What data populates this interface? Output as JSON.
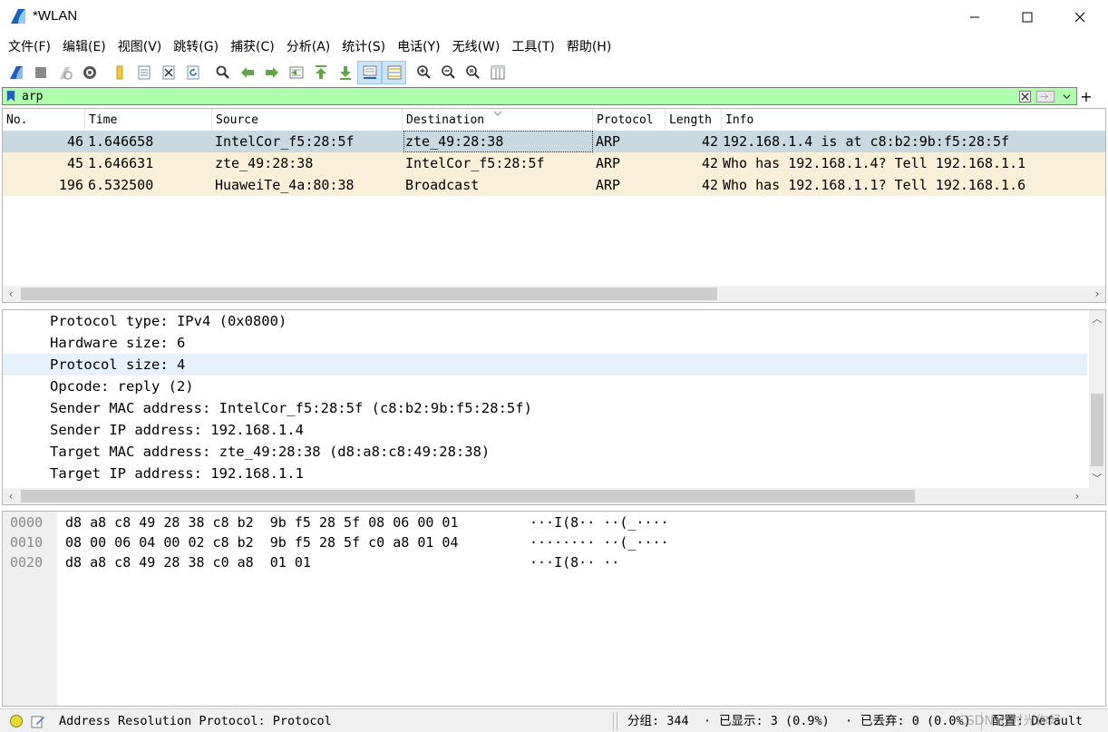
{
  "window": {
    "title": "*WLAN",
    "minimize": "minimize",
    "maximize": "maximize",
    "close": "close"
  },
  "menu": [
    {
      "label": "文件(F)"
    },
    {
      "label": "编辑(E)"
    },
    {
      "label": "视图(V)"
    },
    {
      "label": "跳转(G)"
    },
    {
      "label": "捕获(C)"
    },
    {
      "label": "分析(A)"
    },
    {
      "label": "统计(S)"
    },
    {
      "label": "电话(Y)"
    },
    {
      "label": "无线(W)"
    },
    {
      "label": "工具(T)"
    },
    {
      "label": "帮助(H)"
    }
  ],
  "toolbar": {
    "icons": [
      "shark-fin-start-icon",
      "stop-square-icon",
      "restart-fin-icon",
      "gear-options-icon",
      "folder-open-icon",
      "file-save-icon",
      "file-close-icon",
      "reload-icon",
      "search-icon",
      "arrow-back-icon",
      "arrow-forward-icon",
      "go-to-packet-icon",
      "arrow-up-first-icon",
      "arrow-down-last-icon",
      "autoscroll-icon",
      "colorize-icon",
      "zoom-in-icon",
      "zoom-out-icon",
      "zoom-reset-icon",
      "resize-columns-icon"
    ]
  },
  "filter": {
    "value": "arp",
    "bg_color": "#afffaf"
  },
  "packet_list": {
    "columns": [
      "No.",
      "Time",
      "Source",
      "Destination",
      "Protocol",
      "Length",
      "Info"
    ],
    "rows": [
      {
        "no": "46",
        "time": "1.646658",
        "source": "IntelCor_f5:28:5f",
        "destination": "zte_49:28:38",
        "protocol": "ARP",
        "length": "42",
        "info": "192.168.1.4 is at c8:b2:9b:f5:28:5f",
        "selected": true
      },
      {
        "no": "45",
        "time": "1.646631",
        "source": "zte_49:28:38",
        "destination": "IntelCor_f5:28:5f",
        "protocol": "ARP",
        "length": "42",
        "info": "Who has 192.168.1.4? Tell 192.168.1.1",
        "selected": false
      },
      {
        "no": "196",
        "time": "6.532500",
        "source": "HuaweiTe_4a:80:38",
        "destination": "Broadcast",
        "protocol": "ARP",
        "length": "42",
        "info": "Who has 192.168.1.1? Tell 192.168.1.6",
        "selected": false
      }
    ],
    "selected_color": "#c9d9e1",
    "arp_color": "#faf0d7"
  },
  "details": {
    "lines": [
      "Protocol type: IPv4 (0x0800)",
      "Hardware size: 6",
      "Protocol size: 4",
      "Opcode: reply (2)",
      "Sender MAC address: IntelCor_f5:28:5f (c8:b2:9b:f5:28:5f)",
      "Sender IP address: 192.168.1.4",
      "Target MAC address: zte_49:28:38 (d8:a8:c8:49:28:38)",
      "Target IP address: 192.168.1.1"
    ],
    "highlighted_index": 2
  },
  "bytes": {
    "lines": [
      {
        "offset": "0000",
        "hex": "d8 a8 c8 49 28 38 c8 b2  9b f5 28 5f 08 06 00 01",
        "ascii": "···I(8·· ··(_····"
      },
      {
        "offset": "0010",
        "hex": "08 00 06 04 00 02 c8 b2  9b f5 28 5f c0 a8 01 04",
        "ascii": "········ ··(_····"
      },
      {
        "offset": "0020",
        "hex": "d8 a8 c8 49 28 38 c0 a8  01 01",
        "ascii": "···I(8·· ··"
      }
    ]
  },
  "status": {
    "field": "Address Resolution Protocol: Protocol",
    "packets": "分组: 344",
    "displayed": "已显示: 3 (0.9%)",
    "dropped": "已丢弃: 0 (0.0%)",
    "profile": "配置: Default",
    "watermark": "CSDN @时光你好"
  }
}
